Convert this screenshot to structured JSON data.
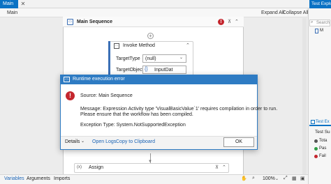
{
  "tabs": {
    "main_label": "Main",
    "close_glyph": "✕",
    "test_explorer_label": "Test Explo"
  },
  "toolbar": {
    "breadcrumb": "Main",
    "expand_all": "Expand All",
    "collapse_all": "Collapse All"
  },
  "sequence": {
    "title": "Main Sequence",
    "error_badge": "!",
    "up_glyph": "⊼",
    "collapse_glyph": "⌃"
  },
  "invoke": {
    "title": "Invoke Method",
    "target_type_label": "TargetType",
    "target_type_value": "(null)",
    "target_object_label": "TargetObject",
    "target_object_value": "InputDat"
  },
  "assign": {
    "title": "Assign",
    "icon_text": "(x)"
  },
  "dialog": {
    "title": "Runtime execution error",
    "source": "Source: Main Sequence",
    "message_line1": "Message: Expression Activity type 'VisualBasicValue`1' requires compilation in order to run.",
    "message_line2": "Please ensure that the workflow has been compiled.",
    "exception": "Exception Type: System.NotSupportedException",
    "details_label": "Details",
    "open_logs": "Open Logs",
    "copy_clipboard": "Copy to Clipboard",
    "ok_label": "OK"
  },
  "right_panel": {
    "search_placeholder": "Search",
    "item_label": "M",
    "test_tab": "Test Ex",
    "test_summary": "Test Su",
    "rows": [
      {
        "label": "Tota",
        "color": "#555555"
      },
      {
        "label": "Pas",
        "color": "#2e9d46"
      },
      {
        "label": "Fail",
        "color": "#c4262e"
      }
    ]
  },
  "statusbar": {
    "variables": "Variables",
    "arguments": "Arguments",
    "imports": "Imports",
    "zoom": "100%"
  }
}
